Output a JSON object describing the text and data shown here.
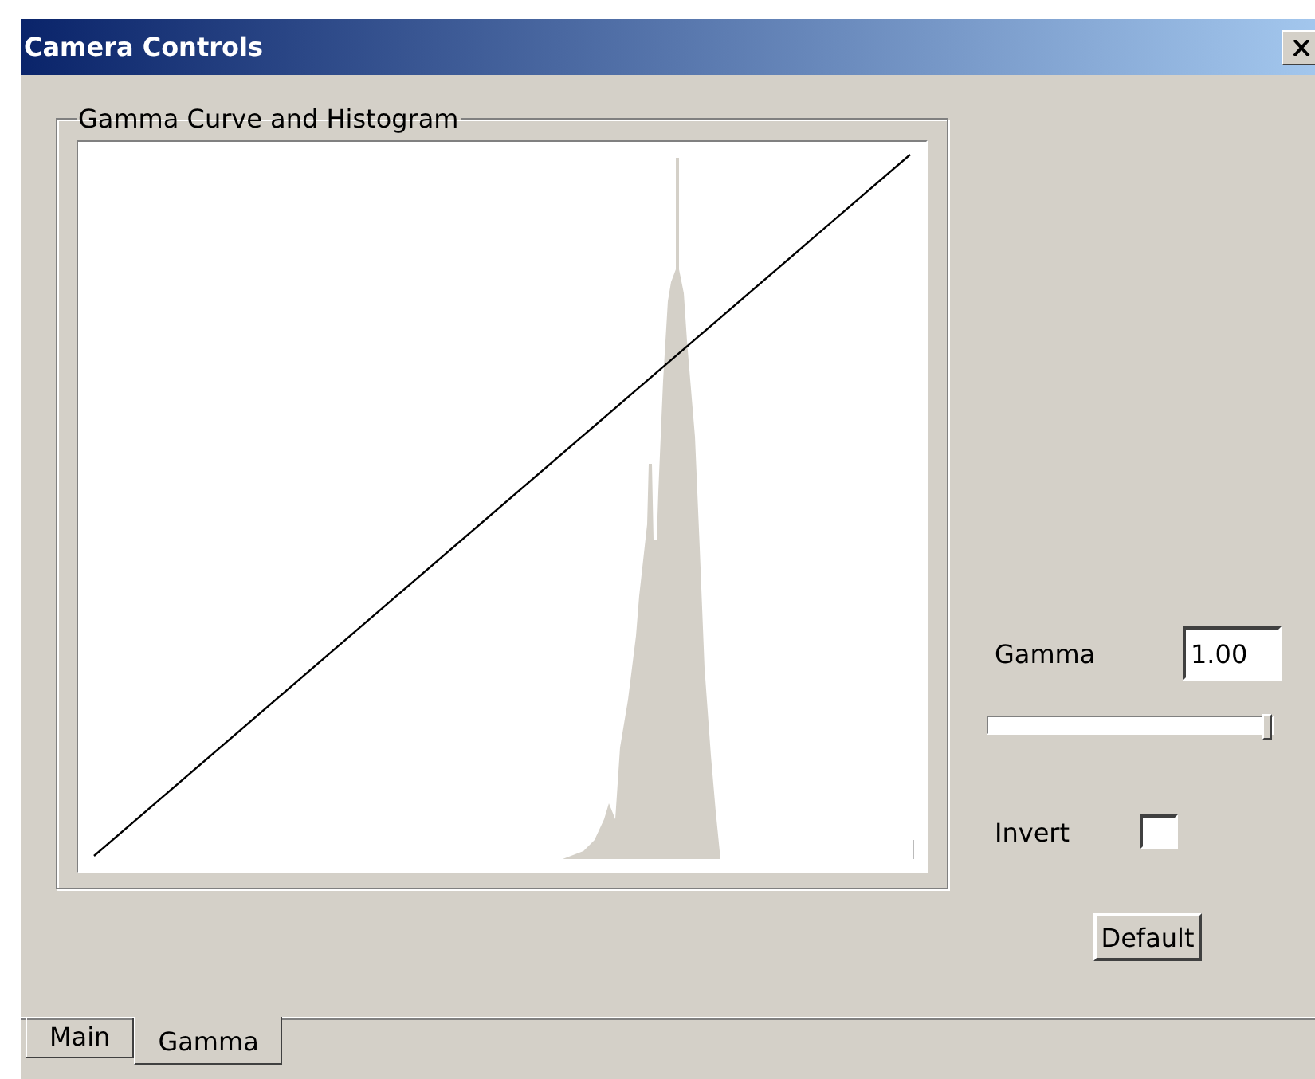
{
  "window": {
    "title": "Camera Controls"
  },
  "group": {
    "title": "Gamma Curve and Histogram"
  },
  "gamma": {
    "label": "Gamma",
    "value": "1.00",
    "level": 1.0
  },
  "invert": {
    "label": "Invert",
    "checked": false
  },
  "buttons": [
    {
      "label": "Default"
    }
  ],
  "tabs": [
    {
      "label": "Main",
      "selected": false
    },
    {
      "label": "Gamma",
      "selected": true
    }
  ]
}
